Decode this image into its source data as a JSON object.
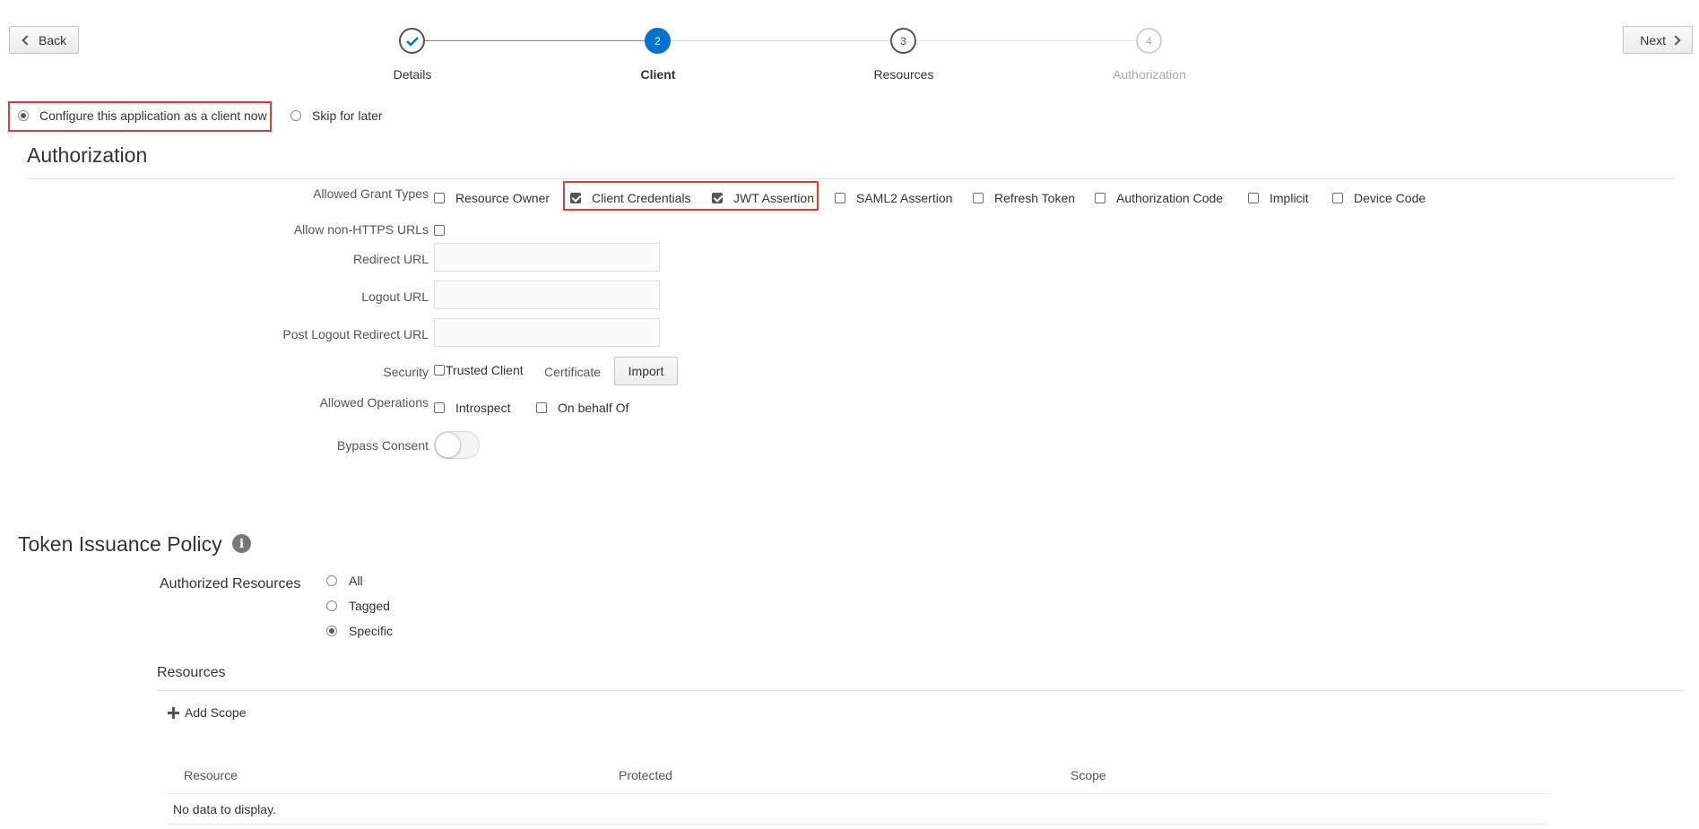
{
  "nav": {
    "back_label": "Back",
    "next_label": "Next"
  },
  "train": {
    "steps": [
      {
        "number": "",
        "label": "Details",
        "state": "done"
      },
      {
        "number": "2",
        "label": "Client",
        "state": "current"
      },
      {
        "number": "3",
        "label": "Resources",
        "state": "upcoming"
      },
      {
        "number": "4",
        "label": "Authorization",
        "state": "disabled"
      }
    ]
  },
  "client_mode": {
    "configure_label": "Configure this application as a client now",
    "skip_label": "Skip for later",
    "selected": "configure"
  },
  "authorization": {
    "title": "Authorization",
    "grant_types_label": "Allowed Grant Types",
    "grant_types": [
      {
        "label": "Resource Owner",
        "checked": false
      },
      {
        "label": "Client Credentials",
        "checked": true
      },
      {
        "label": "JWT Assertion",
        "checked": true
      },
      {
        "label": "SAML2 Assertion",
        "checked": false
      },
      {
        "label": "Refresh Token",
        "checked": false
      },
      {
        "label": "Authorization Code",
        "checked": false
      },
      {
        "label": "Implicit",
        "checked": false
      },
      {
        "label": "Device Code",
        "checked": false
      }
    ],
    "non_https_label": "Allow non-HTTPS URLs",
    "redirect_url_label": "Redirect URL",
    "redirect_url_value": "",
    "logout_url_label": "Logout URL",
    "logout_url_value": "",
    "post_logout_label": "Post Logout Redirect URL",
    "post_logout_value": "",
    "security_label": "Security",
    "trusted_client_label": "Trusted Client",
    "certificate_label": "Certificate",
    "import_label": "Import",
    "allowed_ops_label": "Allowed Operations",
    "ops": [
      {
        "label": "Introspect",
        "checked": false
      },
      {
        "label": "On behalf Of",
        "checked": false
      }
    ],
    "bypass_consent_label": "Bypass Consent",
    "bypass_consent_on": false
  },
  "token_policy": {
    "title": "Token Issuance Policy",
    "authorized_resources_label": "Authorized Resources",
    "options": [
      {
        "label": "All",
        "selected": false
      },
      {
        "label": "Tagged",
        "selected": false
      },
      {
        "label": "Specific",
        "selected": true
      }
    ],
    "resources_heading": "Resources",
    "add_scope_label": "Add Scope",
    "table": {
      "columns": [
        "Resource",
        "Protected",
        "Scope"
      ],
      "empty_text": "No data to display."
    }
  },
  "colors": {
    "accent": "#0572ce",
    "highlight": "#e03a3a",
    "done_check": "#0572ce"
  }
}
